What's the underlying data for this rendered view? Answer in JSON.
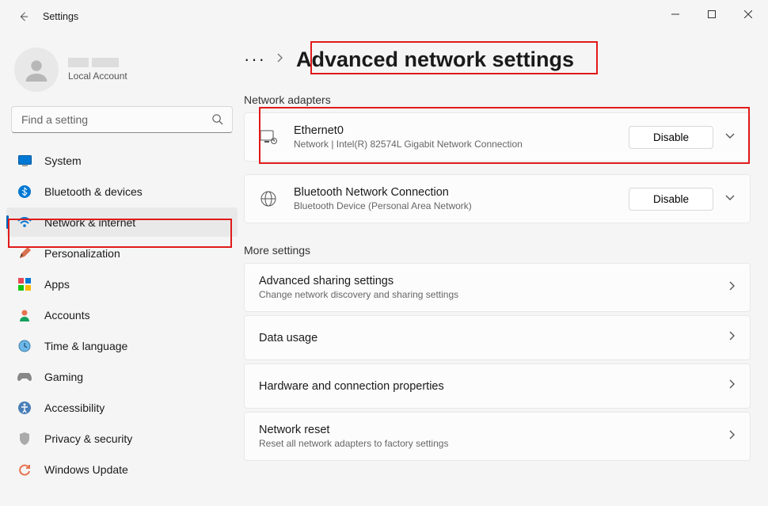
{
  "window": {
    "title": "Settings"
  },
  "account": {
    "sub": "Local Account"
  },
  "search": {
    "placeholder": "Find a setting"
  },
  "sidebar": {
    "items": [
      {
        "label": "System"
      },
      {
        "label": "Bluetooth & devices"
      },
      {
        "label": "Network & internet"
      },
      {
        "label": "Personalization"
      },
      {
        "label": "Apps"
      },
      {
        "label": "Accounts"
      },
      {
        "label": "Time & language"
      },
      {
        "label": "Gaming"
      },
      {
        "label": "Accessibility"
      },
      {
        "label": "Privacy & security"
      },
      {
        "label": "Windows Update"
      }
    ]
  },
  "page": {
    "title": "Advanced network settings"
  },
  "adapters": {
    "section": "Network adapters",
    "items": [
      {
        "name": "Ethernet0",
        "desc": "Network | Intel(R) 82574L Gigabit Network Connection",
        "btn": "Disable"
      },
      {
        "name": "Bluetooth Network Connection",
        "desc": "Bluetooth Device (Personal Area Network)",
        "btn": "Disable"
      }
    ]
  },
  "more": {
    "section": "More settings",
    "items": [
      {
        "name": "Advanced sharing settings",
        "desc": "Change network discovery and sharing settings"
      },
      {
        "name": "Data usage",
        "desc": ""
      },
      {
        "name": "Hardware and connection properties",
        "desc": ""
      },
      {
        "name": "Network reset",
        "desc": "Reset all network adapters to factory settings"
      }
    ]
  }
}
